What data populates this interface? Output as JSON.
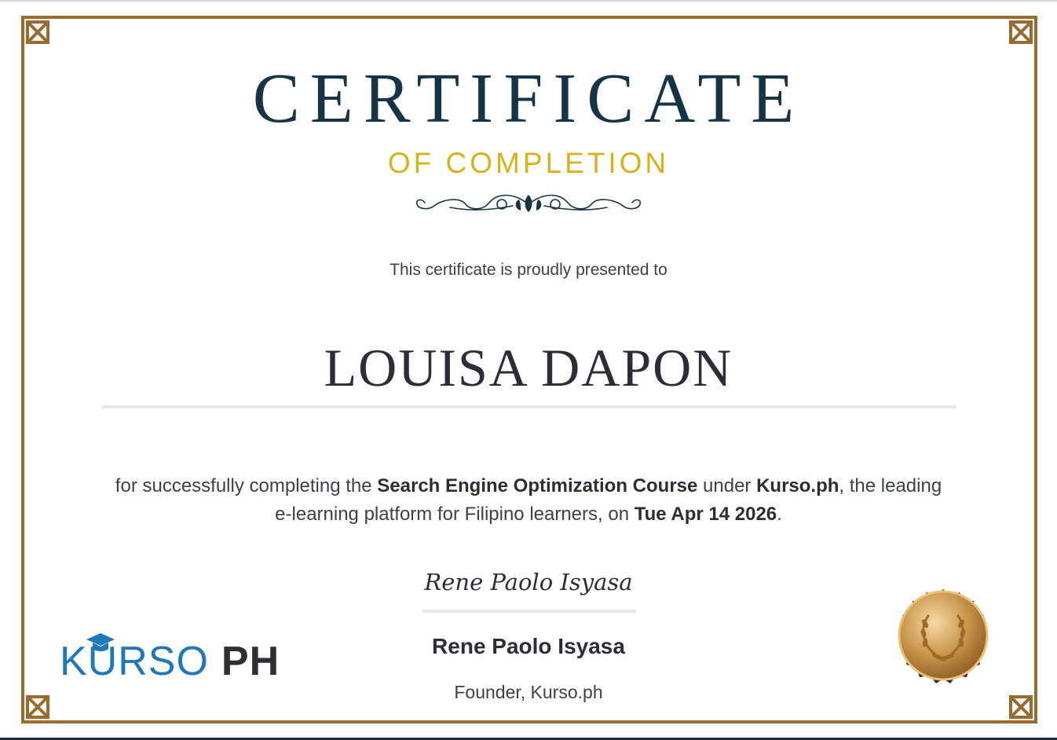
{
  "certificate": {
    "title": "CERTIFICATE",
    "subtitle": "OF COMPLETION",
    "presented_text": "This certificate is proudly presented to",
    "recipient": "LOUISA DAPON",
    "body": {
      "part1": "for successfully completing the ",
      "course": "Search Engine Optimization Course",
      "part2": " under ",
      "platform": "Kurso.ph",
      "part3": ", the leading e-learning platform for Filipino learners, on ",
      "date": "Tue Apr 14 2026",
      "part4": "."
    }
  },
  "signatory": {
    "signature": "Rene Paolo Isyasa",
    "name": "Rene Paolo Isyasa",
    "title": "Founder, Kurso.ph"
  },
  "logo": {
    "brand": "KURSO",
    "suffix": "PH"
  },
  "colors": {
    "frame": "#9a6a2f",
    "title": "#163446",
    "subtitle": "#d8b21c",
    "logo_blue": "#1f78b8",
    "seal_gold": "#c8954a",
    "seal_border": "#2c2a28"
  },
  "icons": {
    "ornament": "flourish-divider",
    "logo_cap": "graduation-cap-icon",
    "seal": "gold-seal-laurel-icon"
  }
}
